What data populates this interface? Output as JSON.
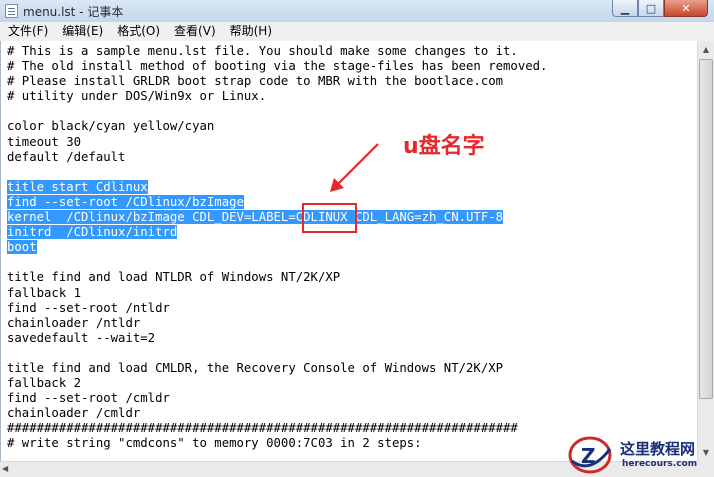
{
  "window": {
    "title": "menu.lst - 记事本",
    "minimize_glyph": "▁",
    "maximize_glyph": "□",
    "close_glyph": "✕"
  },
  "menubar": {
    "items": [
      "文件(F)",
      "编辑(E)",
      "格式(O)",
      "查看(V)",
      "帮助(H)"
    ]
  },
  "editor": {
    "lines": [
      {
        "text": "# This is a sample menu.lst file. You should make some changes to it.",
        "selected": false
      },
      {
        "text": "# The old install method of booting via the stage-files has been removed.",
        "selected": false
      },
      {
        "text": "# Please install GRLDR boot strap code to MBR with the bootlace.com",
        "selected": false
      },
      {
        "text": "# utility under DOS/Win9x or Linux.",
        "selected": false
      },
      {
        "text": "",
        "selected": false
      },
      {
        "text": "color black/cyan yellow/cyan",
        "selected": false
      },
      {
        "text": "timeout 30",
        "selected": false
      },
      {
        "text": "default /default",
        "selected": false
      },
      {
        "text": "",
        "selected": false
      },
      {
        "text": "title start Cdlinux",
        "selected": true
      },
      {
        "text": "find --set-root /CDlinux/bzImage",
        "selected": true
      },
      {
        "text": "kernel  /CDlinux/bzImage CDL_DEV=LABEL=CDLINUX CDL_LANG=zh_CN.UTF-8",
        "selected": true
      },
      {
        "text": "initrd  /CDlinux/initrd",
        "selected": true
      },
      {
        "text": "boot",
        "selected": true
      },
      {
        "text": "",
        "selected": false
      },
      {
        "text": "title find and load NTLDR of Windows NT/2K/XP",
        "selected": false
      },
      {
        "text": "fallback 1",
        "selected": false
      },
      {
        "text": "find --set-root /ntldr",
        "selected": false
      },
      {
        "text": "chainloader /ntldr",
        "selected": false
      },
      {
        "text": "savedefault --wait=2",
        "selected": false
      },
      {
        "text": "",
        "selected": false
      },
      {
        "text": "title find and load CMLDR, the Recovery Console of Windows NT/2K/XP",
        "selected": false
      },
      {
        "text": "fallback 2",
        "selected": false
      },
      {
        "text": "find --set-root /cmldr",
        "selected": false
      },
      {
        "text": "chainloader /cmldr",
        "selected": false
      },
      {
        "text": "#####################################################################",
        "selected": false
      },
      {
        "text": "# write string \"cmdcons\" to memory 0000:7C03 in 2 steps:",
        "selected": false
      }
    ]
  },
  "annotation": {
    "label": "u盘名字",
    "color": "#e8262b"
  },
  "watermark": {
    "name_cn": "这里教程网",
    "domain": "herecours.com",
    "mark_letter": "Z"
  },
  "colors": {
    "selection": "#3399ff",
    "annotation_red": "#e8262b"
  },
  "icons": {
    "app": "notepad-icon",
    "scroll_up": "arrow-up-icon",
    "scroll_down": "arrow-down-icon",
    "scroll_left": "arrow-left-icon"
  }
}
